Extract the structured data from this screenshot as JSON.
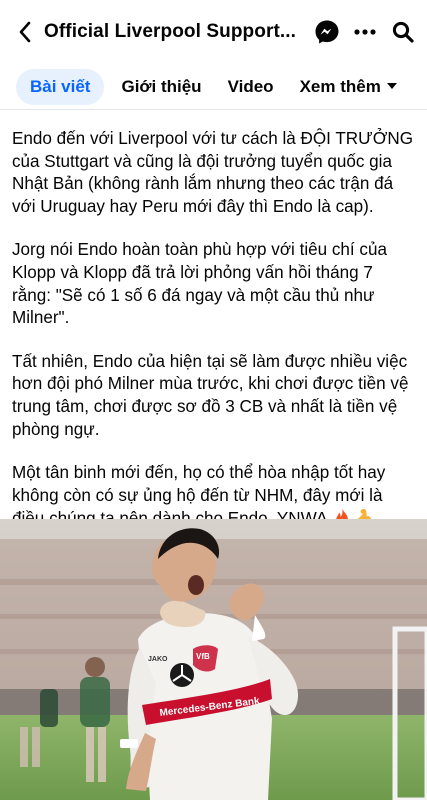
{
  "header": {
    "title": "Official Liverpool Support...",
    "back_icon": "back-arrow-icon",
    "icons": [
      "messenger-icon",
      "more-options-icon",
      "search-icon"
    ]
  },
  "tabs": [
    {
      "label": "Bài viết",
      "active": true
    },
    {
      "label": "Giới thiệu",
      "active": false
    },
    {
      "label": "Video",
      "active": false
    },
    {
      "label": "Xem thêm",
      "active": false
    }
  ],
  "post": {
    "paragraphs": [
      "Endo đến với Liverpool với tư cách là ĐỘI TRƯỞNG của Stuttgart và cũng là đội trưởng tuyển quốc gia Nhật Bản (không rành lắm nhưng theo các trận đá với Uruguay hay Peru mới đây thì Endo là cap).",
      "Jorg nói Endo hoàn toàn phù hợp với tiêu chí của Klopp và Klopp đã trả lời phỏng vấn hồi tháng 7 rằng: \"Sẽ có 1 số 6 đá ngay và một cầu thủ như Milner\".",
      "Tất nhiên, Endo của hiện tại sẽ làm được nhiều việc hơn đội phó Milner mùa trước, khi chơi được tiền vệ trung tâm, chơi được sơ đồ 3 CB và nhất là tiền vệ phòng ngự.",
      "Một tân binh mới đến, họ có thể hòa nhập tốt hay không còn có sự ủng hộ đến từ NHM, đây mới là điều chúng ta nên dành cho Endo, YNWA"
    ],
    "emojis": [
      "fire-emoji",
      "flexed-biceps-emoji"
    ]
  },
  "photo": {
    "jersey_text": "VfB",
    "sponsor_text": "Mercedes-Benz Bank",
    "kit_brand": "JAKO"
  },
  "colors": {
    "accent": "#0866ff",
    "active_tab_bg": "#e7f0fd",
    "text": "#050505"
  }
}
